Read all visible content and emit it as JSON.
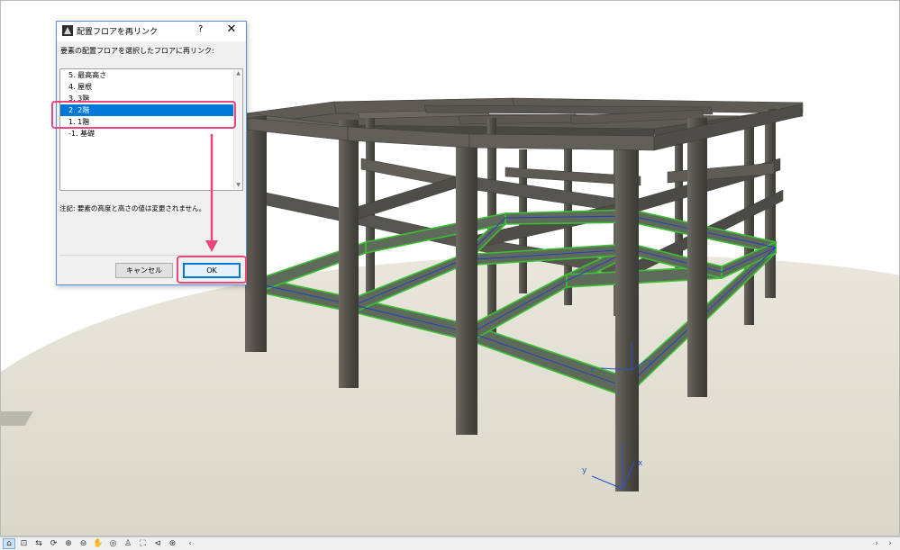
{
  "dialog": {
    "title": "配置フロアを再リンク",
    "help_label": "?",
    "close_label": "✕",
    "instruction": "要素の配置フロアを選択したフロアに再リンク:",
    "stories": [
      {
        "label": "5. 最高高さ",
        "selected": false
      },
      {
        "label": "4. 屋根",
        "selected": false
      },
      {
        "label": "3. 3階",
        "selected": false
      },
      {
        "label": "2. 2階",
        "selected": true
      },
      {
        "label": "1. 1階",
        "selected": false
      },
      {
        "label": "-1. 基礎",
        "selected": false
      }
    ],
    "note": "注記: 要素の高度と高さの値は変更されません。",
    "cancel_label": "キャンセル",
    "ok_label": "OK"
  },
  "viewport": {
    "axis_x_label": "x",
    "axis_y_label": "y",
    "axis_small_x_label": "x",
    "axis_small_y_label": "y"
  },
  "toolbar": {
    "tools": [
      {
        "name": "3d-window-icon",
        "glyph": "⌂"
      },
      {
        "name": "zoom-fit-icon",
        "glyph": "⊡"
      },
      {
        "name": "zoom-previous-icon",
        "glyph": "⇆"
      },
      {
        "name": "zoom-rotate-icon",
        "glyph": "⟳"
      },
      {
        "name": "zoom-in-icon",
        "glyph": "⊕"
      },
      {
        "name": "zoom-out-icon",
        "glyph": "⊖"
      },
      {
        "name": "pan-icon",
        "glyph": "✋"
      },
      {
        "name": "orbit-icon",
        "glyph": "◎"
      },
      {
        "name": "explore-icon",
        "glyph": "♙"
      },
      {
        "name": "fit-in-window-icon",
        "glyph": "⛶"
      },
      {
        "name": "zoom-navigate-icon",
        "glyph": "⊲"
      },
      {
        "name": "view-options-icon",
        "glyph": "⊛"
      }
    ],
    "scroll_left": "‹",
    "scroll_right": "›",
    "scroll_end": "›"
  },
  "colors": {
    "selection": "#0078d7",
    "highlight": "#e8467e",
    "concrete": "#55534c",
    "beam_selected": "#3bbf33",
    "ground": "#e1dfd2"
  }
}
